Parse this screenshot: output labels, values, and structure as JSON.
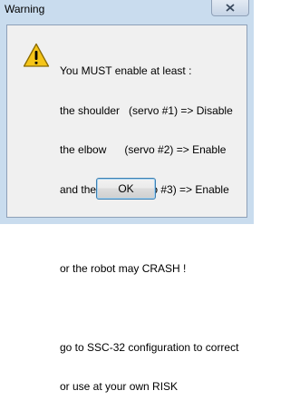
{
  "window": {
    "title": "Warning",
    "close_icon": "close-icon"
  },
  "message": {
    "icon": "warning-icon",
    "lines": [
      "You MUST enable at least :",
      "the shoulder   (servo #1) => Disable",
      "the elbow      (servo #2) => Enable",
      "and the wrist  (servo #3) => Enable",
      "",
      "or the robot may CRASH !",
      "",
      "go to SSC-32 configuration to correct",
      "or use at your own RISK"
    ]
  },
  "buttons": {
    "ok_label": "OK"
  },
  "colors": {
    "frame": "#c9dcee",
    "client": "#f0f0f0",
    "warning_fill": "#f5c518"
  }
}
